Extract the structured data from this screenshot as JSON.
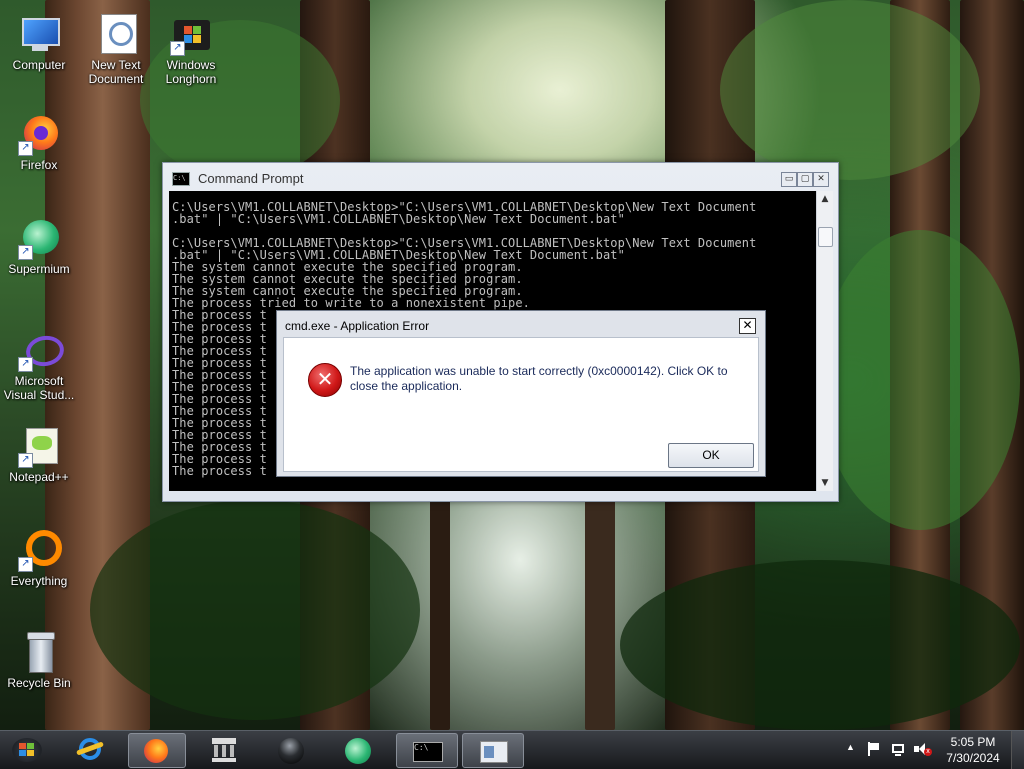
{
  "desktop": {
    "icons": [
      {
        "label": "Computer",
        "icon": "computer-icon"
      },
      {
        "label": "New Text Document",
        "icon": "text-document-icon"
      },
      {
        "label": "Windows Longhorn",
        "icon": "windows-longhorn-icon"
      },
      {
        "label": "Firefox",
        "icon": "firefox-icon"
      },
      {
        "label": "Supermium",
        "icon": "supermium-icon"
      },
      {
        "label": "Microsoft Visual Stud...",
        "icon": "visual-studio-icon"
      },
      {
        "label": "Notepad++",
        "icon": "notepad-plus-plus-icon"
      },
      {
        "label": "Everything",
        "icon": "everything-icon"
      },
      {
        "label": "Recycle Bin",
        "icon": "recycle-bin-icon"
      }
    ]
  },
  "cmd_window": {
    "title": "Command Prompt",
    "icon_text": "C:\\",
    "console_text": "C:\\Users\\VM1.COLLABNET\\Desktop>\"C:\\Users\\VM1.COLLABNET\\Desktop\\New Text Document\n.bat\" | \"C:\\Users\\VM1.COLLABNET\\Desktop\\New Text Document.bat\"\n\nC:\\Users\\VM1.COLLABNET\\Desktop>\"C:\\Users\\VM1.COLLABNET\\Desktop\\New Text Document\n.bat\" | \"C:\\Users\\VM1.COLLABNET\\Desktop\\New Text Document.bat\"\nThe system cannot execute the specified program.\nThe system cannot execute the specified program.\nThe system cannot execute the specified program.\nThe process tried to write to a nonexistent pipe.\nThe process t\nThe process t\nThe process t\nThe process t\nThe process t\nThe process t\nThe process t\nThe process t\nThe process t\nThe process t\nThe process t\nThe process t\nThe process t\nThe process t",
    "buttons": {
      "minimize": "▭",
      "maximize": "▢",
      "close": "✕"
    }
  },
  "error_dialog": {
    "title": "cmd.exe - Application Error",
    "close_glyph": "✕",
    "icon_glyph": "✕",
    "message": "The application was unable to start correctly (0xc0000142). Click OK to close the application.",
    "ok_label": "OK"
  },
  "taskbar": {
    "start_label": "Start",
    "items": [
      {
        "name": "Internet Explorer",
        "icon": "internet-explorer-icon",
        "active": false
      },
      {
        "name": "Firefox",
        "icon": "firefox-icon",
        "active": true
      },
      {
        "name": "Library",
        "icon": "library-icon",
        "active": false
      },
      {
        "name": "Dark orb",
        "icon": "orb-icon",
        "active": false
      },
      {
        "name": "Supermium",
        "icon": "supermium-icon",
        "active": false
      },
      {
        "name": "Command Prompt",
        "icon": "cmd-icon",
        "active": true,
        "icon_text": "C:\\"
      },
      {
        "name": "Application",
        "icon": "app-window-icon",
        "active": true
      }
    ],
    "tray": {
      "show_hidden": "▲",
      "clock_time": "5:05 PM",
      "clock_date": "7/30/2024"
    }
  }
}
